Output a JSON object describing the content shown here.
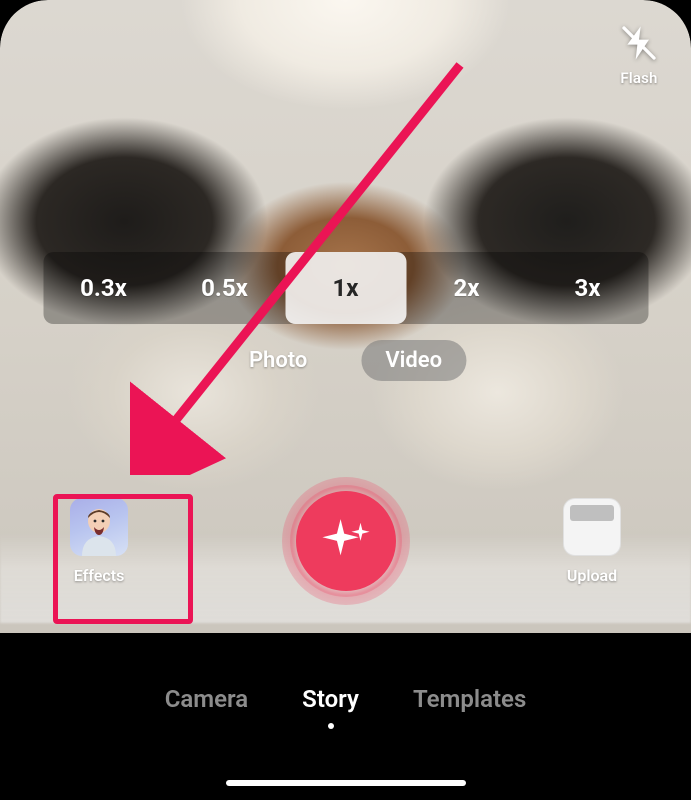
{
  "flash": {
    "label": "Flash"
  },
  "zoom": {
    "options": [
      "0.3x",
      "0.5x",
      "1x",
      "2x",
      "3x"
    ],
    "selected_index": 2
  },
  "capture_mode": {
    "options": [
      "Photo",
      "Video"
    ],
    "selected_index": 1
  },
  "effects": {
    "label": "Effects"
  },
  "upload": {
    "label": "Upload"
  },
  "bottom_nav": {
    "options": [
      "Camera",
      "Story",
      "Templates"
    ],
    "selected_index": 1
  },
  "annotation": {
    "type": "arrow+box",
    "target": "effects-button",
    "color": "#eb1455"
  }
}
